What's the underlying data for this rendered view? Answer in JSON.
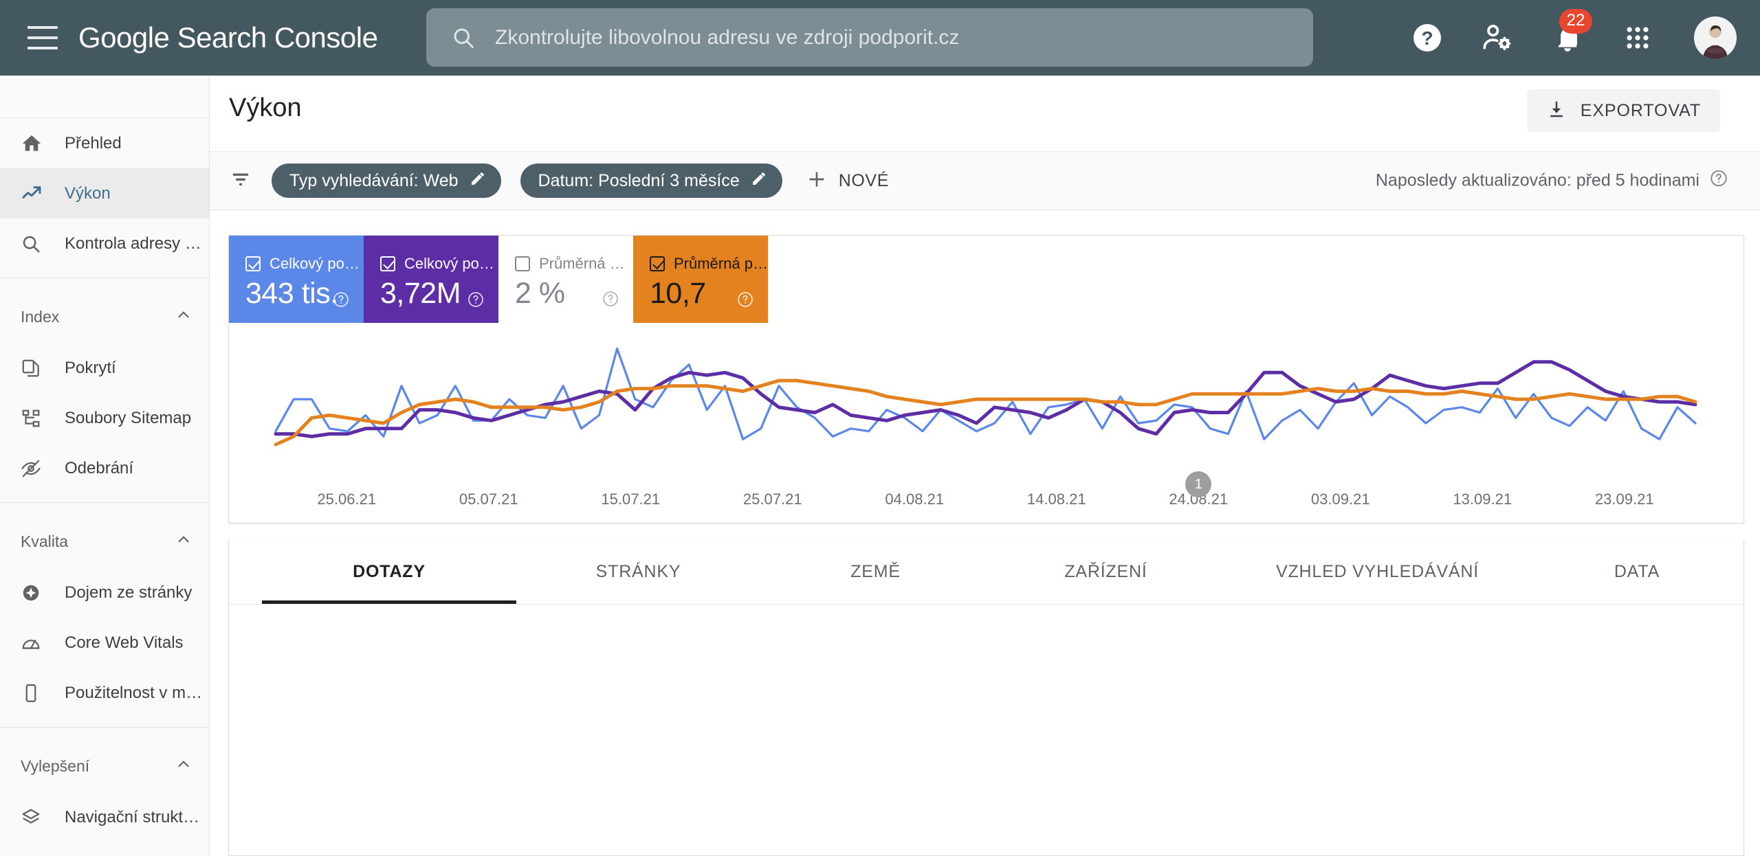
{
  "appbar": {
    "menu_icon": "hamburger-icon",
    "brand": "Google Search Console",
    "search": {
      "icon": "search-icon",
      "placeholder": "Zkontrolujte libovolnou adresu ve zdroji podporit.cz",
      "value": ""
    },
    "icons": [
      {
        "name": "help-icon"
      },
      {
        "name": "account-settings-icon"
      },
      {
        "name": "notifications-bell-icon",
        "badge": "22"
      },
      {
        "name": "apps-grid-icon"
      },
      {
        "name": "avatar"
      }
    ]
  },
  "sidebar": {
    "items": [
      {
        "label": "Přehled",
        "icon": "home-icon",
        "active": false
      },
      {
        "label": "Výkon",
        "icon": "trending-up-icon",
        "active": true
      },
      {
        "label": "Kontrola adresy URL",
        "icon": "search-icon",
        "active": false
      }
    ],
    "sections": [
      {
        "title": "Index",
        "items": [
          {
            "label": "Pokrytí",
            "icon": "copy-pages-icon"
          },
          {
            "label": "Soubory Sitemap",
            "icon": "sitemap-icon"
          },
          {
            "label": "Odebrání",
            "icon": "eye-off-icon"
          }
        ]
      },
      {
        "title": "Kvalita",
        "items": [
          {
            "label": "Dojem ze stránky",
            "icon": "page-experience-icon"
          },
          {
            "label": "Core Web Vitals",
            "icon": "speedometer-icon"
          },
          {
            "label": "Použitelnost v mobilních zaříze…",
            "icon": "mobile-phone-icon"
          }
        ]
      },
      {
        "title": "Vylepšení",
        "items": [
          {
            "label": "Navigační struktura",
            "icon": "layers-icon"
          }
        ]
      }
    ]
  },
  "page": {
    "title": "Výkon",
    "export_label": "EXPORTOVAT",
    "export_icon": "download-icon"
  },
  "filters": {
    "filter_icon": "filter-icon",
    "chips": [
      {
        "label": "Typ vyhledávání: Web",
        "edit_icon": "pencil-icon"
      },
      {
        "label": "Datum: Poslední 3 měsíce",
        "edit_icon": "pencil-icon"
      }
    ],
    "new_label": "NOVÉ",
    "new_icon": "plus-icon",
    "updated_text": "Naposledy aktualizováno: před 5 hodinami",
    "updated_help_icon": "help-circle-icon"
  },
  "metrics": [
    {
      "label": "Celkový počet kli…",
      "value": "343 tis.",
      "checked": true,
      "color": "#5A87E8",
      "help_icon": "help-circle-icon"
    },
    {
      "label": "Celkový počet zo…",
      "value": "3,72M",
      "checked": true,
      "color": "#5D2DA6",
      "help_icon": "help-circle-icon"
    },
    {
      "label": "Průměrná míra pr…",
      "value": "2 %",
      "checked": false,
      "color": "#ffffff",
      "help_icon": "help-circle-icon"
    },
    {
      "label": "Průměrná pozice",
      "value": "10,7",
      "checked": true,
      "color": "#E3821E",
      "help_icon": "help-circle-icon"
    }
  ],
  "chart_data": {
    "type": "line",
    "title": "",
    "xlabel": "",
    "ylabel": "",
    "grid": false,
    "legend": "none",
    "x_tick_labels": [
      "25.06.21",
      "05.07.21",
      "15.07.21",
      "25.07.21",
      "04.08.21",
      "14.08.21",
      "24.08.21",
      "03.09.21",
      "13.09.21",
      "23.09.21"
    ],
    "annotations": [
      {
        "label": "1",
        "x_label": "24.08.21"
      }
    ],
    "series": [
      {
        "name": "Celkový počet kliknutí",
        "color": "#5A87E8",
        "values": [
          28,
          52,
          52,
          30,
          28,
          40,
          24,
          62,
          34,
          40,
          62,
          36,
          36,
          52,
          40,
          38,
          62,
          30,
          40,
          90,
          52,
          46,
          66,
          78,
          44,
          62,
          22,
          30,
          62,
          46,
          38,
          24,
          30,
          28,
          44,
          38,
          28,
          44,
          36,
          28,
          34,
          50,
          26,
          46,
          48,
          52,
          30,
          54,
          34,
          36,
          48,
          46,
          30,
          26,
          58,
          22,
          36,
          44,
          30,
          50,
          64,
          40,
          54,
          46,
          34,
          44,
          46,
          42,
          60,
          38,
          56,
          38,
          32,
          46,
          36,
          58,
          30,
          22,
          46,
          34
        ]
      },
      {
        "name": "Celkový počet zobrazení",
        "color": "#5D2DA6",
        "values": [
          26,
          26,
          24,
          26,
          26,
          30,
          30,
          30,
          44,
          44,
          42,
          38,
          36,
          40,
          44,
          48,
          50,
          54,
          58,
          56,
          44,
          60,
          68,
          72,
          70,
          72,
          68,
          56,
          46,
          44,
          42,
          48,
          40,
          38,
          36,
          40,
          42,
          44,
          40,
          34,
          46,
          44,
          42,
          38,
          44,
          52,
          50,
          42,
          30,
          26,
          42,
          44,
          42,
          42,
          56,
          72,
          72,
          62,
          56,
          50,
          52,
          60,
          70,
          66,
          62,
          60,
          62,
          64,
          64,
          72,
          80,
          80,
          74,
          66,
          58,
          54,
          52,
          50,
          50,
          48
        ]
      },
      {
        "name": "Průměrná pozice",
        "color": "#E3821E",
        "values": [
          18,
          24,
          38,
          40,
          38,
          36,
          34,
          42,
          48,
          50,
          52,
          50,
          46,
          46,
          46,
          46,
          44,
          46,
          50,
          58,
          60,
          60,
          62,
          62,
          62,
          60,
          58,
          62,
          66,
          66,
          64,
          62,
          60,
          58,
          54,
          52,
          50,
          48,
          50,
          52,
          52,
          52,
          52,
          52,
          52,
          52,
          50,
          50,
          48,
          48,
          52,
          56,
          56,
          56,
          56,
          56,
          56,
          58,
          60,
          58,
          58,
          60,
          58,
          58,
          56,
          56,
          58,
          56,
          54,
          52,
          52,
          54,
          56,
          54,
          52,
          52,
          52,
          54,
          54,
          50
        ]
      }
    ]
  },
  "tabs": [
    {
      "label": "DOTAZY",
      "active": true
    },
    {
      "label": "STRÁNKY",
      "active": false
    },
    {
      "label": "ZEMĚ",
      "active": false
    },
    {
      "label": "ZAŘÍZENÍ",
      "active": false
    },
    {
      "label": "VZHLED VYHLEDÁVÁNÍ",
      "active": false
    },
    {
      "label": "DATA",
      "active": false
    }
  ]
}
